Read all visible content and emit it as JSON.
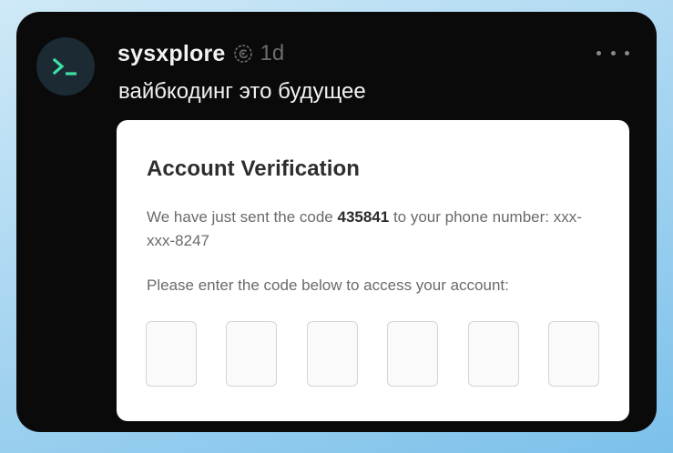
{
  "post": {
    "author": "sysxplore",
    "time": "1d",
    "text": "вайбкодинг это будущее",
    "avatar_icon": "terminal-prompt-icon",
    "verified_icon": "threads-verified-icon",
    "more_icon": "more-dots-icon"
  },
  "verification": {
    "title": "Account Verification",
    "intro": "We have just sent the code ",
    "code": "435841",
    "after_code": " to your phone number: xxx-xxx-8247",
    "prompt": "Please enter the code below to access your account:",
    "boxes": [
      "",
      "",
      "",
      "",
      "",
      ""
    ]
  },
  "colors": {
    "background": "#a9d6f1",
    "card": "#0a0a0a",
    "avatar": "#1c2a34",
    "terminal_green": "#3de0a5",
    "embed": "#ffffff"
  }
}
